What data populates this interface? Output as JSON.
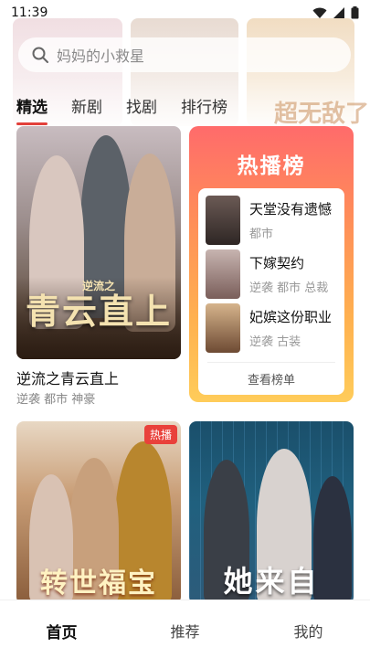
{
  "status": {
    "time": "11:39"
  },
  "search": {
    "placeholder": "妈妈的小救星"
  },
  "tabs": [
    {
      "label": "精选",
      "active": true
    },
    {
      "label": "新剧",
      "active": false
    },
    {
      "label": "找剧",
      "active": false
    },
    {
      "label": "排行榜",
      "active": false
    }
  ],
  "featured": {
    "poster_art": "青云直上",
    "poster_art_small": "逆流之",
    "title": "逆流之青云直上",
    "tags": "逆袭 都市 神豪"
  },
  "ranking": {
    "title": "热播榜",
    "items": [
      {
        "name": "天堂没有遗憾",
        "tags": "都市"
      },
      {
        "name": "下嫁契约",
        "tags": "逆袭 都市 总裁"
      },
      {
        "name": "妃嫔这份职业",
        "tags": "逆袭 古装"
      }
    ],
    "more_label": "查看榜单"
  },
  "grid": [
    {
      "poster_art": "转世福宝",
      "badge": "热播"
    },
    {
      "poster_art": "她来自"
    }
  ],
  "banner": {
    "tile_text": "超无敌了"
  },
  "nav": [
    {
      "label": "首页",
      "active": true
    },
    {
      "label": "推荐",
      "active": false
    },
    {
      "label": "我的",
      "active": false
    }
  ],
  "colors": {
    "accent": "#e2403a",
    "rank_gradient_top": "#ff6b6b",
    "rank_gradient_bottom": "#ffcc5a"
  }
}
